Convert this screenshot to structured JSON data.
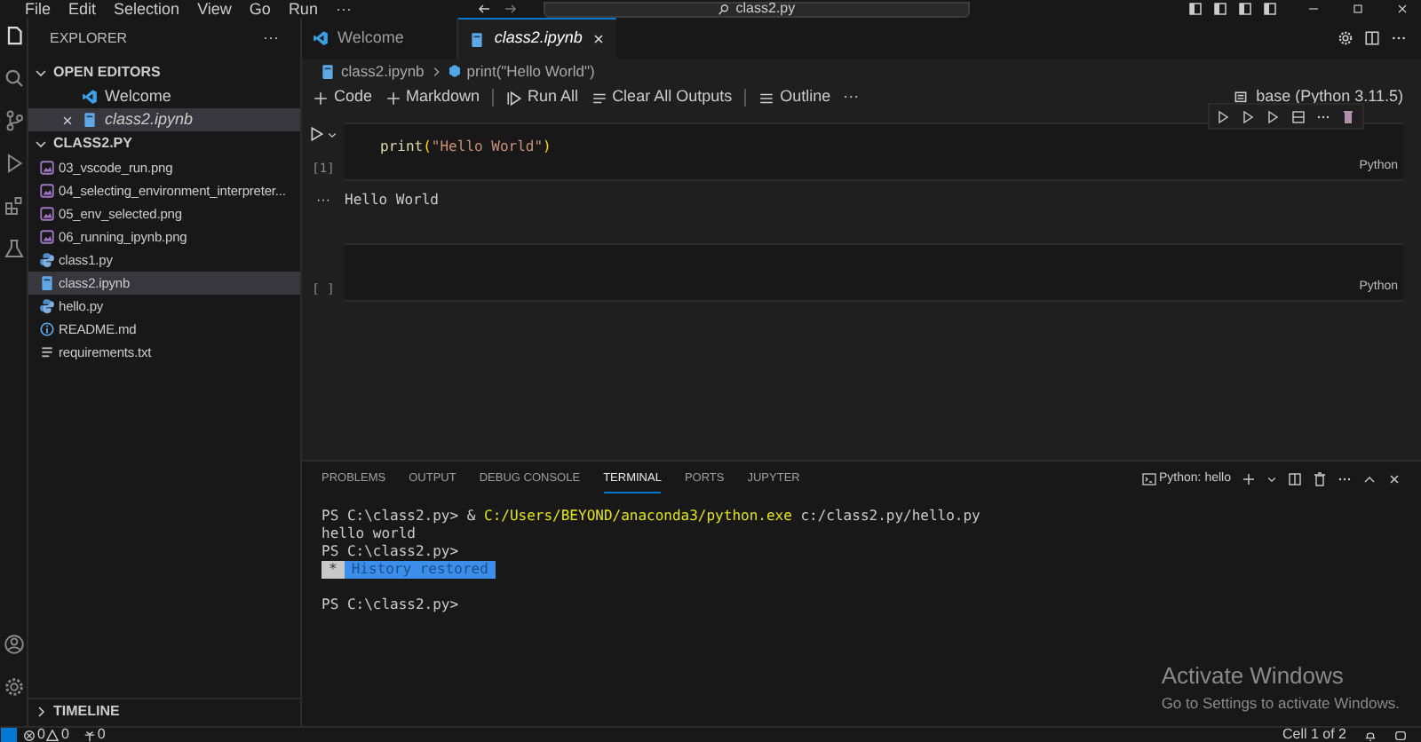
{
  "menu": [
    "File",
    "Edit",
    "Selection",
    "View",
    "Go",
    "Run",
    "···"
  ],
  "search": {
    "value": "class2.py"
  },
  "sidebar": {
    "title": "EXPLORER",
    "more": "···",
    "open_editors": {
      "label": "OPEN EDITORS",
      "expanded": true,
      "items": [
        {
          "name": "Welcome",
          "kind": "vscode",
          "selected": false,
          "preview": false
        },
        {
          "name": "class2.ipynb",
          "kind": "notebook",
          "selected": true,
          "preview": true
        }
      ]
    },
    "folder": {
      "label": "CLASS2.PY",
      "expanded": true,
      "files": [
        {
          "name": "03_vscode_run.png",
          "kind": "image",
          "selected": false
        },
        {
          "name": "04_selecting_environment_interpreter...",
          "kind": "image",
          "selected": false
        },
        {
          "name": "05_env_selected.png",
          "kind": "image",
          "selected": false
        },
        {
          "name": "06_running_ipynb.png",
          "kind": "image",
          "selected": false
        },
        {
          "name": "class1.py",
          "kind": "python",
          "selected": false
        },
        {
          "name": "class2.ipynb",
          "kind": "notebook",
          "selected": true
        },
        {
          "name": "hello.py",
          "kind": "python",
          "selected": false
        },
        {
          "name": "README.md",
          "kind": "info",
          "selected": false
        },
        {
          "name": "requirements.txt",
          "kind": "text",
          "selected": false
        }
      ]
    },
    "timeline": {
      "label": "TIMELINE",
      "expanded": false
    }
  },
  "tabs": [
    {
      "label": "Welcome",
      "kind": "vscode",
      "selected": false
    },
    {
      "label": "class2.ipynb",
      "kind": "notebook",
      "selected": true
    }
  ],
  "breadcrumb": [
    "class2.ipynb",
    "print(\"Hello World\")"
  ],
  "toolbar": [
    {
      "kind": "add",
      "label": "Code"
    },
    {
      "kind": "add",
      "label": "Markdown"
    },
    {
      "kind": "run",
      "label": "Run All"
    },
    {
      "kind": "clear",
      "label": "Clear All Outputs"
    },
    {
      "kind": "outline",
      "label": "Outline"
    },
    {
      "kind": "more",
      "label": "···"
    }
  ],
  "kernel": "base (Python 3.11.5)",
  "cells": [
    {
      "code_tokens": [
        {
          "kind": "function",
          "text": "print"
        },
        {
          "kind": "bracket",
          "text": "("
        },
        {
          "kind": "string",
          "text": "\"Hello World\""
        },
        {
          "kind": "bracket",
          "text": ")"
        }
      ],
      "exec": "[1]",
      "language": "Python",
      "output": "Hello World",
      "focused": true
    },
    {
      "exec": "[ ]",
      "language": "Python",
      "focused": false
    }
  ],
  "output_more": "···",
  "panel": {
    "tabs": [
      {
        "label": "PROBLEMS",
        "selected": false
      },
      {
        "label": "OUTPUT",
        "selected": false
      },
      {
        "label": "DEBUG CONSOLE",
        "selected": false
      },
      {
        "label": "TERMINAL",
        "selected": true
      },
      {
        "label": "PORTS",
        "selected": false
      },
      {
        "label": "JUPYTER",
        "selected": false
      }
    ],
    "profile": "Python: hello",
    "terminal": [
      {
        "kind": "text",
        "segments": [
          {
            "kind": "plain",
            "text": "PS C:\\class2.py> & "
          },
          {
            "kind": "path",
            "text": "C:/Users/BEYOND/anaconda3/python.exe"
          },
          {
            "kind": "plain",
            "text": " c:/class2.py/hello.py"
          }
        ]
      },
      {
        "kind": "text",
        "segments": [
          {
            "kind": "plain",
            "text": "hello world"
          }
        ]
      },
      {
        "kind": "text",
        "segments": [
          {
            "kind": "plain",
            "text": "PS C:\\class2.py>"
          }
        ]
      },
      {
        "kind": "notice",
        "mark": "*",
        "text": "History restored"
      },
      {
        "kind": "blank"
      },
      {
        "kind": "text",
        "segments": [
          {
            "kind": "plain",
            "text": "PS C:\\class2.py>"
          }
        ]
      }
    ]
  },
  "activation": {
    "title": "Activate Windows",
    "subtitle": "Go to Settings to activate Windows."
  },
  "status": {
    "errors": "0",
    "warnings": "0",
    "ports": "0",
    "cell": "Cell 1 of 2"
  }
}
